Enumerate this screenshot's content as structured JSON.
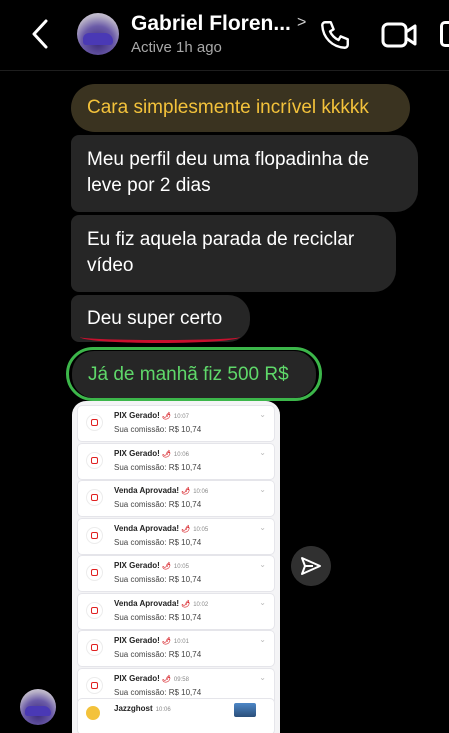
{
  "header": {
    "contact_name": "Gabriel Floren...",
    "status": "Active 1h ago",
    "back_icon": "chevron-left-icon",
    "call_icon": "phone-icon",
    "video_icon": "video-camera-icon"
  },
  "messages": [
    {
      "text": "Cara simplesmente incrível kkkkk",
      "highlight": "#f3c23b"
    },
    {
      "text": "Meu perfil deu uma flopadinha de leve por 2 dias"
    },
    {
      "text": "Eu fiz aquela parada de reciclar vídeo"
    },
    {
      "text": "Deu super certo",
      "underline": "#c8102e"
    },
    {
      "text": "Já de manhã fiz 500 R$",
      "circle": "#3cb64a"
    }
  ],
  "screenshot": {
    "notifications": [
      {
        "title": "PIX Gerado!",
        "time": "10:07",
        "subtitle": "Sua comissão: R$ 10,74"
      },
      {
        "title": "PIX Gerado!",
        "time": "10:06",
        "subtitle": "Sua comissão: R$ 10,74"
      },
      {
        "title": "Venda Aprovada!",
        "time": "10:06",
        "subtitle": "Sua comissão: R$ 10,74"
      },
      {
        "title": "Venda Aprovada!",
        "time": "10:05",
        "subtitle": "Sua comissão: R$ 10,74"
      },
      {
        "title": "PIX Gerado!",
        "time": "10:05",
        "subtitle": "Sua comissão: R$ 10,74"
      },
      {
        "title": "Venda Aprovada!",
        "time": "10:02",
        "subtitle": "Sua comissão: R$ 10,74"
      },
      {
        "title": "PIX Gerado!",
        "time": "10:01",
        "subtitle": "Sua comissão: R$ 10,74"
      },
      {
        "title": "PIX Gerado!",
        "time": "09:58",
        "subtitle": "Sua comissão: R$ 10,74"
      }
    ],
    "last": {
      "title": "Jazzghost",
      "time": "10:06"
    }
  },
  "share_icon": "paper-plane-icon",
  "colors": {
    "bubble": "#262626",
    "background": "#000000"
  }
}
